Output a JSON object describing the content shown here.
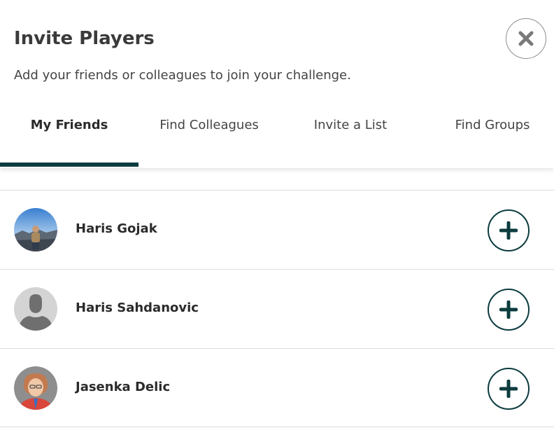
{
  "dialog": {
    "title": "Invite Players",
    "subtitle": "Add your friends or colleagues to join your challenge.",
    "close_icon": "close-icon"
  },
  "tabs": [
    {
      "label": "My Friends",
      "active": true
    },
    {
      "label": "Find Colleagues",
      "active": false
    },
    {
      "label": "Invite a List",
      "active": false
    },
    {
      "label": "Find Groups",
      "active": false
    }
  ],
  "friends": [
    {
      "name": "Haris Gojak",
      "avatar": "photo-avatar",
      "action_icon": "plus-icon"
    },
    {
      "name": "Haris Sahdanovic",
      "avatar": "default-person-avatar",
      "action_icon": "plus-icon"
    },
    {
      "name": "Jasenka Delic",
      "avatar": "photo-avatar",
      "action_icon": "plus-icon"
    }
  ],
  "colors": {
    "accent": "#0d3c3f",
    "divider": "#dddddd",
    "text": "#333333"
  }
}
